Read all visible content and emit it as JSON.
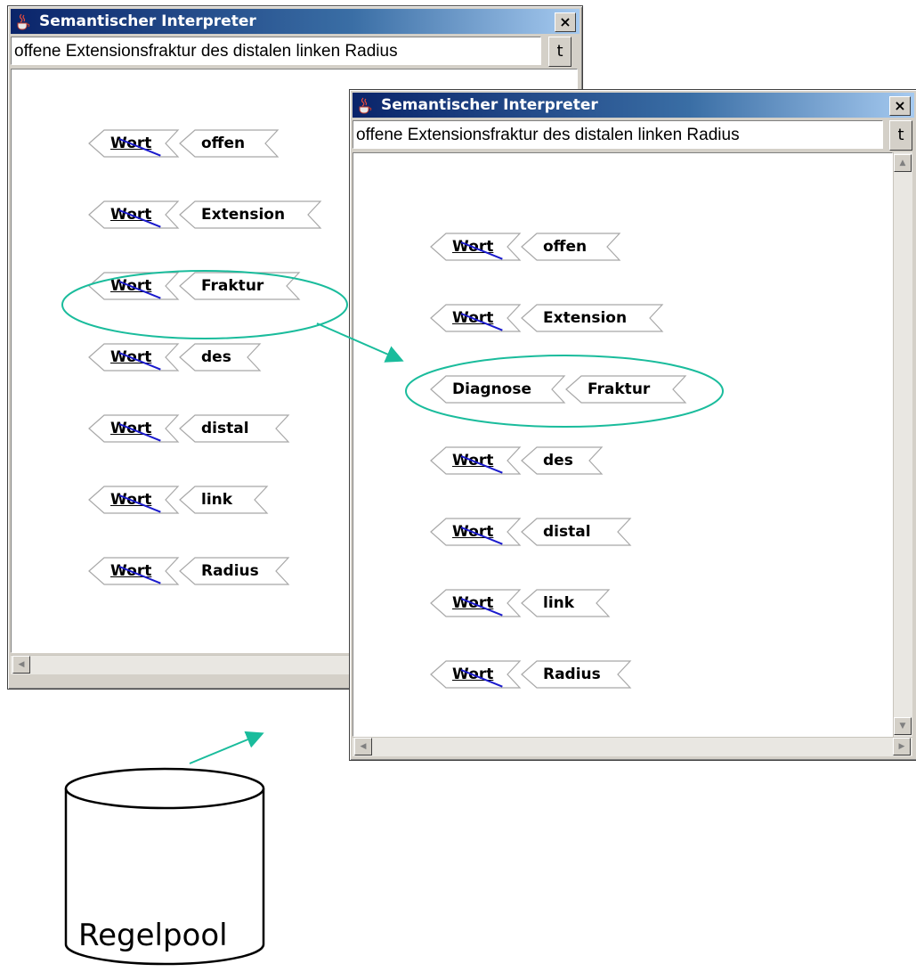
{
  "windows": [
    {
      "title": "Semantischer Interpreter",
      "close_label": "×",
      "input_value": "offene Extensionsfraktur des distalen linken Radius",
      "t_button": "t",
      "tokens": [
        {
          "type": "Wort",
          "value": "offen"
        },
        {
          "type": "Wort",
          "value": "Extension"
        },
        {
          "type": "Wort",
          "value": "Fraktur"
        },
        {
          "type": "Wort",
          "value": "des"
        },
        {
          "type": "Wort",
          "value": "distal"
        },
        {
          "type": "Wort",
          "value": "link"
        },
        {
          "type": "Wort",
          "value": "Radius"
        }
      ]
    },
    {
      "title": "Semantischer Interpreter",
      "close_label": "×",
      "input_value": "offene Extensionsfraktur des distalen linken Radius",
      "t_button": "t",
      "tokens": [
        {
          "type": "Wort",
          "value": "offen"
        },
        {
          "type": "Wort",
          "value": "Extension"
        },
        {
          "type": "Diagnose",
          "value": "Fraktur"
        },
        {
          "type": "Wort",
          "value": "des"
        },
        {
          "type": "Wort",
          "value": "distal"
        },
        {
          "type": "Wort",
          "value": "link"
        },
        {
          "type": "Wort",
          "value": "Radius"
        }
      ]
    }
  ],
  "rule_pool": {
    "label": "Regelpool"
  },
  "colors": {
    "annotation": "#1abc9c",
    "slash": "#1a1acc",
    "titlebar_start": "#0a246a",
    "titlebar_end": "#a6caf0"
  }
}
